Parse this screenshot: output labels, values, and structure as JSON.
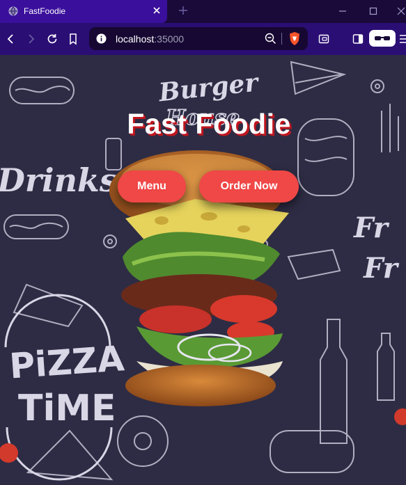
{
  "browser": {
    "tab_title": "FastFoodie",
    "url_host": "localhost",
    "url_port": ":35000"
  },
  "hero": {
    "title": "Fast Foodie",
    "buttons": {
      "menu": "Menu",
      "order": "Order Now"
    }
  },
  "background_art": {
    "lettering": [
      "Burger House",
      "Drinks",
      "Pizza Time",
      "Fries"
    ]
  },
  "colors": {
    "tab_active": "#3a0f9c",
    "toolbar": "#2a0e74",
    "button": "#f04747",
    "title_shadow": "#c0161f",
    "page_bg": "#2e2c44"
  }
}
